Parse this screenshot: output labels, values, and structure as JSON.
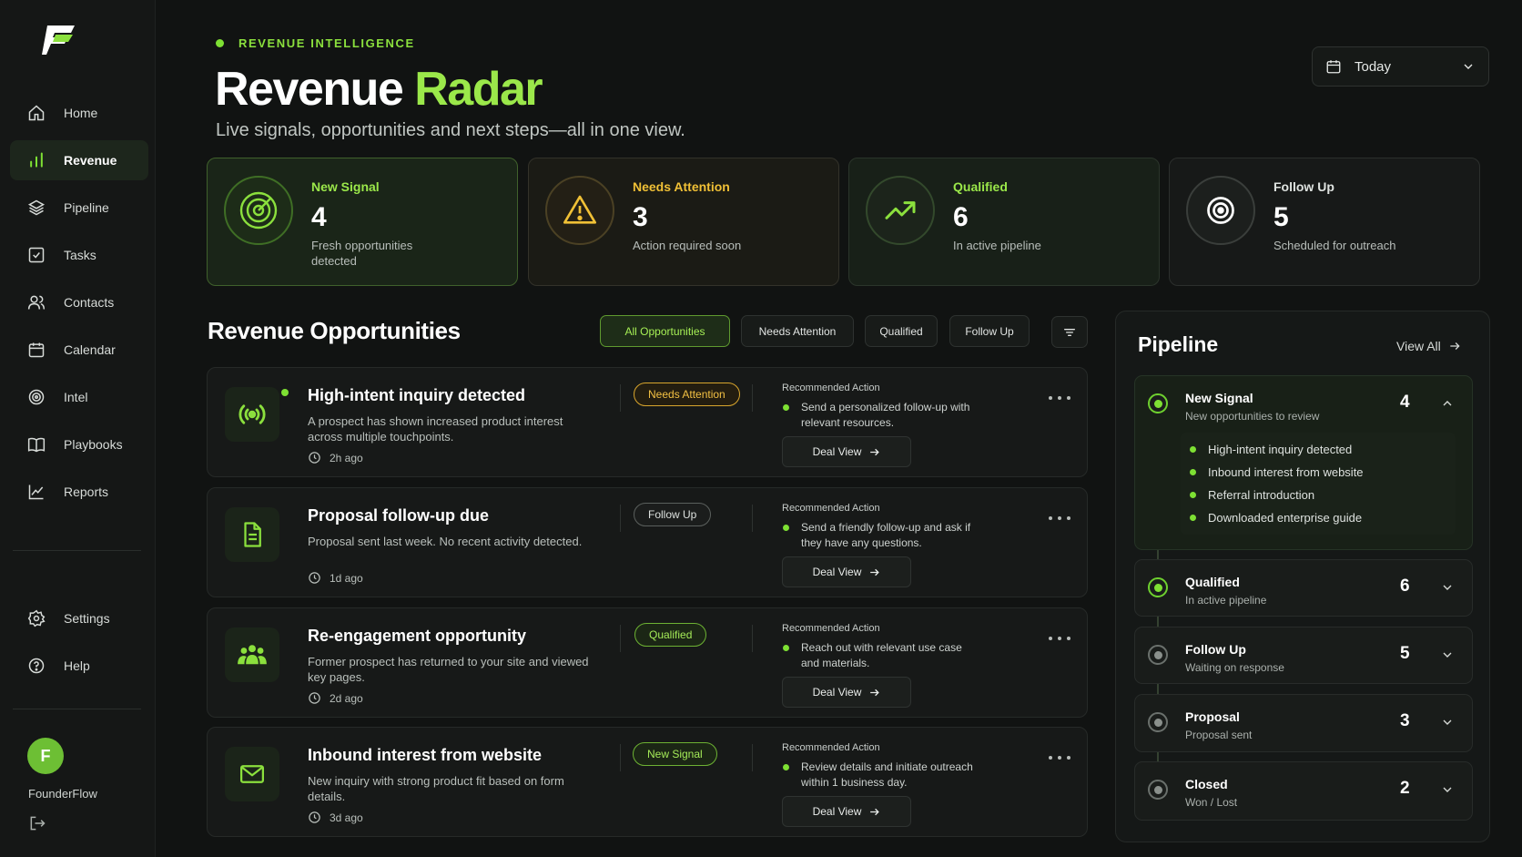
{
  "sidebar": {
    "nav": [
      {
        "label": "Home",
        "icon": "home-icon",
        "active": false
      },
      {
        "label": "Revenue",
        "icon": "bar-chart-icon",
        "active": true
      },
      {
        "label": "Pipeline",
        "icon": "layers-icon",
        "active": false
      },
      {
        "label": "Tasks",
        "icon": "checkbox-icon",
        "active": false
      },
      {
        "label": "Contacts",
        "icon": "users-icon",
        "active": false
      },
      {
        "label": "Calendar",
        "icon": "calendar-icon",
        "active": false
      },
      {
        "label": "Intel",
        "icon": "target-icon",
        "active": false
      },
      {
        "label": "Playbooks",
        "icon": "book-icon",
        "active": false
      },
      {
        "label": "Reports",
        "icon": "line-chart-icon",
        "active": false
      }
    ],
    "secondary": [
      {
        "label": "Settings",
        "icon": "gear-icon"
      },
      {
        "label": "Help",
        "icon": "help-icon"
      }
    ],
    "user": {
      "initial": "F",
      "name": "FounderFlow"
    }
  },
  "header": {
    "eyebrow": "REVENUE INTELLIGENCE",
    "title_main": "Revenue",
    "title_accent": "Radar",
    "subtitle": "Live signals, opportunities and next  steps—all in one view.",
    "date_select": "Today"
  },
  "stats": [
    {
      "label": "New Signal",
      "value": "4",
      "desc": "Fresh opportunities detected",
      "icon": "radar-icon"
    },
    {
      "label": "Needs Attention",
      "value": "3",
      "desc": "Action required soon",
      "icon": "warning-icon"
    },
    {
      "label": "Qualified",
      "value": "6",
      "desc": "In active pipeline",
      "icon": "trending-up-icon"
    },
    {
      "label": "Follow Up",
      "value": "5",
      "desc": "Scheduled for outreach",
      "icon": "target-icon"
    }
  ],
  "opportunities": {
    "title": "Revenue Opportunities",
    "filters": [
      "All Opportunities",
      "Needs Attention",
      "Qualified",
      "Follow Up"
    ],
    "active_filter": "All Opportunities",
    "ra_label": "Recommended Action",
    "deal_label": "Deal View",
    "items": [
      {
        "title": "High-intent inquiry detected",
        "desc": "A prospect has shown increased product interest across multiple touchpoints.",
        "time": "2h ago",
        "badge": "Needs Attention",
        "action": "Send a personalized follow-up with relevant resources.",
        "icon": "broadcast-icon"
      },
      {
        "title": "Proposal follow-up due",
        "desc": "Proposal sent last week. No recent activity detected.",
        "time": "1d ago",
        "badge": "Follow Up",
        "action": "Send a friendly follow-up and ask if they have any questions.",
        "icon": "document-icon"
      },
      {
        "title": "Re-engagement opportunity",
        "desc": "Former prospect has returned to your site and viewed key pages.",
        "time": "2d ago",
        "badge": "Qualified",
        "action": "Reach out with relevant use case and materials.",
        "icon": "group-icon"
      },
      {
        "title": "Inbound interest from website",
        "desc": "New inquiry with strong product fit based on form details.",
        "time": "3d ago",
        "badge": "New Signal",
        "action": "Review details and initiate outreach within 1 business day.",
        "icon": "mail-icon"
      }
    ]
  },
  "pipeline": {
    "title": "Pipeline",
    "view_all": "View All",
    "stages": [
      {
        "name": "New Signal",
        "sub": "New opportunities to review",
        "count": "4",
        "expanded": true,
        "items": [
          "High-intent inquiry detected",
          "Inbound interest from website",
          "Referral introduction",
          "Downloaded enterprise guide"
        ]
      },
      {
        "name": "Qualified",
        "sub": "In active pipeline",
        "count": "6",
        "expanded": false
      },
      {
        "name": "Follow Up",
        "sub": "Waiting on response",
        "count": "5",
        "expanded": false
      },
      {
        "name": "Proposal",
        "sub": "Proposal sent",
        "count": "3",
        "expanded": false
      },
      {
        "name": "Closed",
        "sub": "Won / Lost",
        "count": "2",
        "expanded": false
      }
    ]
  },
  "colors": {
    "accent": "#9be84a",
    "warning": "#f0c036",
    "bg": "#111312"
  }
}
